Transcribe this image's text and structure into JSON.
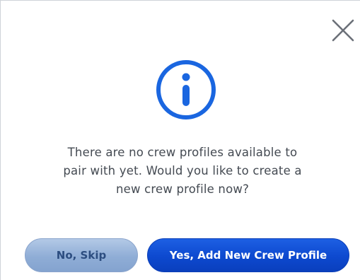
{
  "dialog": {
    "message_lines": [
      "There are no crew profiles available to",
      "pair with yet. Would you like to create a",
      "new crew profile now?"
    ],
    "skip_label": "No, Skip",
    "add_label": "Yes, Add New Crew Profile"
  },
  "colors": {
    "accent": "#1a66e0",
    "primary_button": "#0d49cf",
    "secondary_button": "#8fadd6",
    "text": "#444a52"
  },
  "icons": {
    "close": "close-icon",
    "info": "info-icon"
  }
}
